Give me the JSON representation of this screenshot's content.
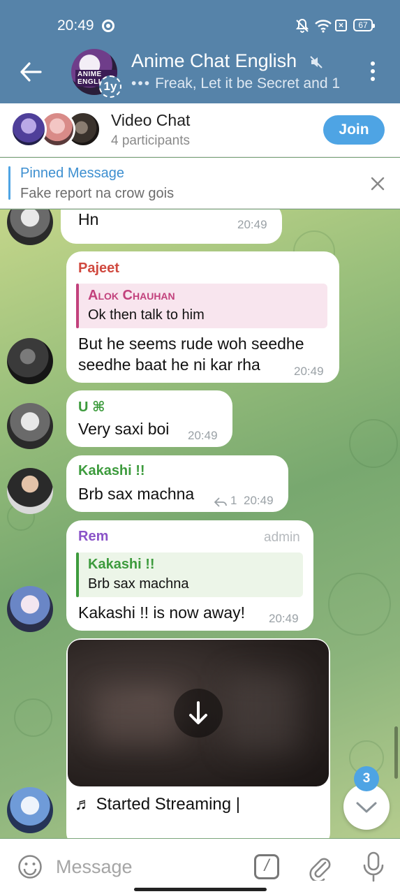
{
  "status": {
    "time": "20:49",
    "battery": "67"
  },
  "header": {
    "title": "Anime Chat English",
    "typing_dots": "•••",
    "subtitle": "Freak, Let it be Secret and 1",
    "avatar_badge": "1y",
    "avatar_text": "ANIME ENGLI"
  },
  "video_chat": {
    "title": "Video Chat",
    "participants": "4 participants",
    "join_label": "Join"
  },
  "pinned": {
    "title": "Pinned Message",
    "text": "Fake report na crow gois"
  },
  "messages": [
    {
      "text": "Hn",
      "time": "20:49"
    },
    {
      "sender": "Pajeet",
      "reply_name": "Alok Chauhan",
      "reply_text": "Ok then talk to him",
      "text_line1": "But he seems rude woh seedhe",
      "text_line2": "seedhe baat he ni kar rha",
      "time": "20:49"
    },
    {
      "sender": "U ⌘",
      "text": "Very saxi boi",
      "time": "20:49"
    },
    {
      "sender": "Kakashi !!",
      "text": "Brb sax machna",
      "reply_count": "1",
      "time": "20:49"
    },
    {
      "sender": "Rem",
      "role": "admin",
      "reply_name": "Kakashi !!",
      "reply_text": "Brb sax machna",
      "text": "Kakashi !! is now away!",
      "time": "20:49"
    },
    {
      "caption": "♬ Started Streaming |"
    }
  ],
  "scroll": {
    "unread_count": "3"
  },
  "composer": {
    "placeholder": "Message",
    "command_label": "/"
  },
  "colors": {
    "header_bg": "#5683a9",
    "accent": "#4ea4e4",
    "pajeet": "#d0493f",
    "alok": "#c2417c",
    "u_user": "#3d9b3d",
    "kakashi": "#3d9b3d",
    "rem": "#8a53c8"
  }
}
